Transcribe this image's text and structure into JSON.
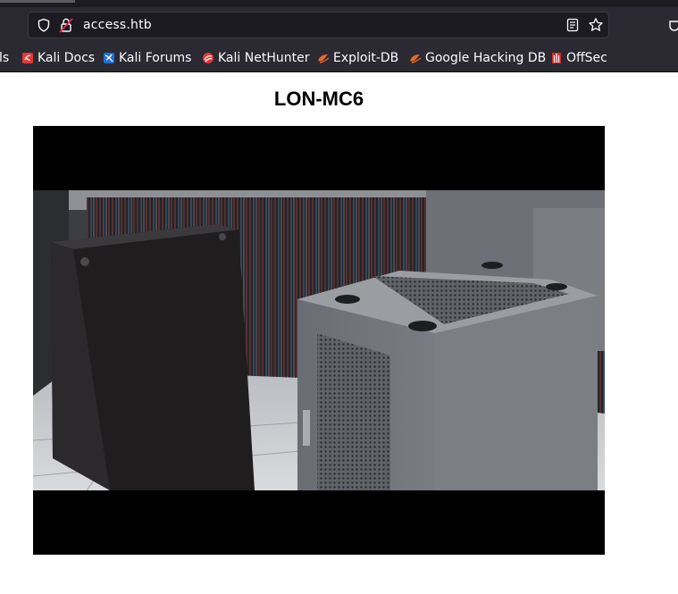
{
  "browser": {
    "url": "access.htb",
    "bookmarks": [
      {
        "label": "ls",
        "icon": "none"
      },
      {
        "label": "Kali Docs",
        "icon": "kali-docs-icon",
        "color": "#e53935"
      },
      {
        "label": "Kali Forums",
        "icon": "kali-forums-icon",
        "color": "#1e6fd9"
      },
      {
        "label": "Kali NetHunter",
        "icon": "kali-nethunter-icon",
        "color": "#e53935"
      },
      {
        "label": "Exploit-DB",
        "icon": "exploit-db-icon",
        "color": "#e8692a"
      },
      {
        "label": "Google Hacking DB",
        "icon": "ghdb-icon",
        "color": "#e8692a"
      },
      {
        "label": "OffSec",
        "icon": "offsec-icon",
        "color": "#d32f2f"
      }
    ]
  },
  "page": {
    "title": "LON-MC6"
  },
  "colors": {
    "toolbar": "#2b2a33",
    "urlbar": "#1c1b22",
    "text": "#fbfbfe"
  }
}
